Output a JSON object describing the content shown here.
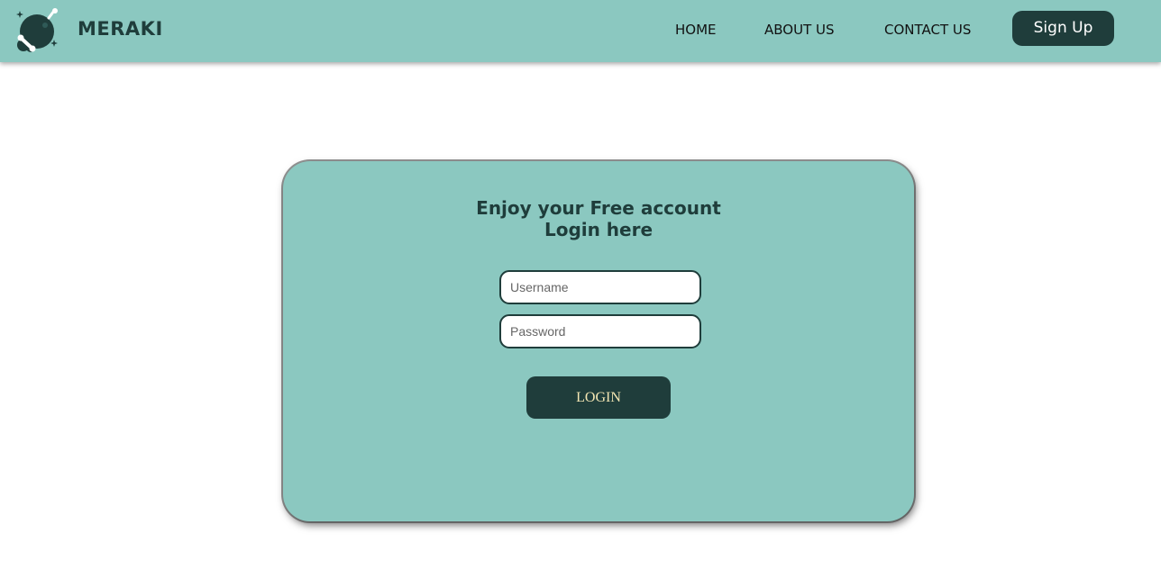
{
  "brand": {
    "name": "MERAKI",
    "logo_icon": "planet-logo-icon"
  },
  "nav": {
    "items": [
      {
        "label": "HOME"
      },
      {
        "label": "ABOUT US"
      },
      {
        "label": "CONTACT US"
      }
    ],
    "signup_label": "Sign Up"
  },
  "login_card": {
    "heading_line1": "Enjoy your Free account",
    "heading_line2": "Login here",
    "username_placeholder": "Username",
    "password_placeholder": "Password",
    "username_value": "",
    "password_value": "",
    "login_label": "LOGIN"
  },
  "colors": {
    "accent": "#8bc8c0",
    "dark": "#1f3d3b",
    "login_text": "#f3e6b3",
    "background": "#ffffff"
  }
}
